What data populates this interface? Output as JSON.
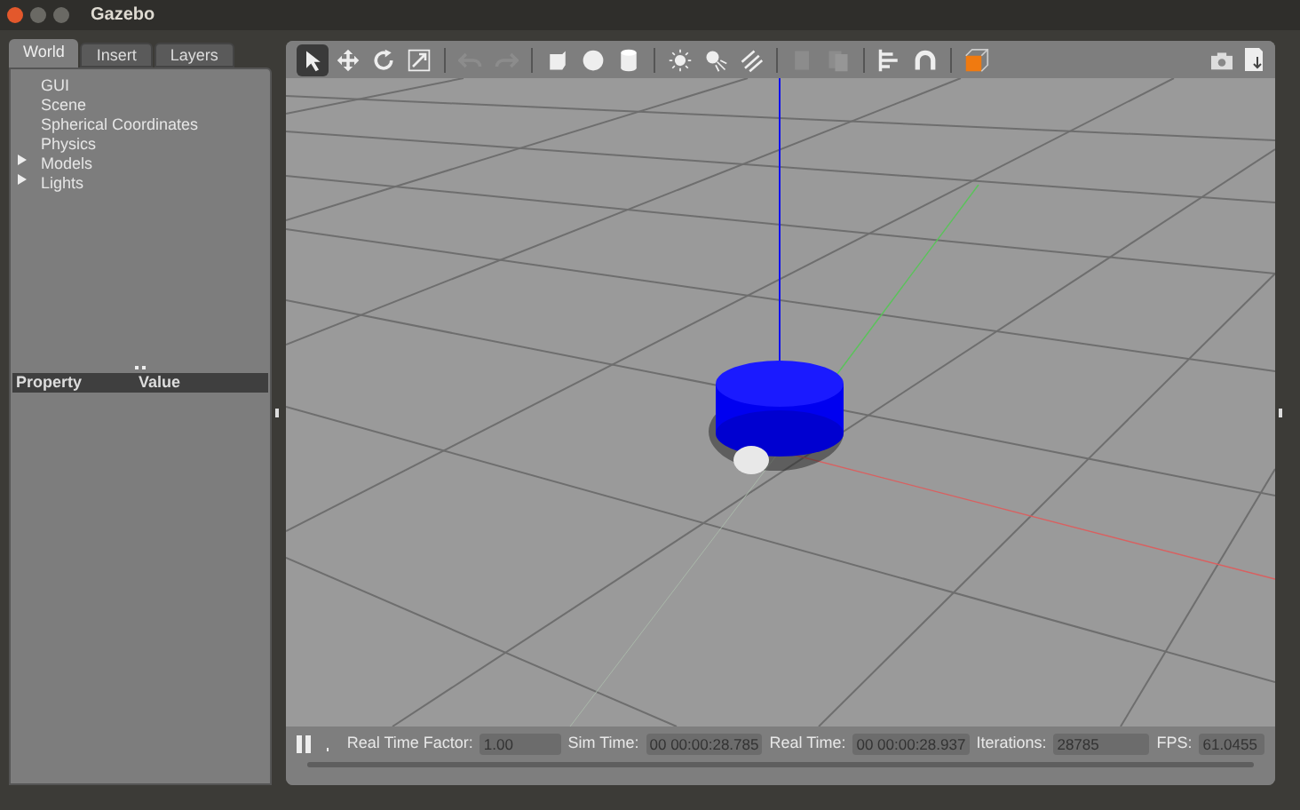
{
  "window": {
    "title": "Gazebo"
  },
  "tabs": [
    {
      "label": "World",
      "selected": true
    },
    {
      "label": "Insert",
      "selected": false
    },
    {
      "label": "Layers",
      "selected": false
    }
  ],
  "tree": [
    {
      "label": "GUI",
      "has_children": false
    },
    {
      "label": "Scene",
      "has_children": false
    },
    {
      "label": "Spherical Coordinates",
      "has_children": false
    },
    {
      "label": "Physics",
      "has_children": false
    },
    {
      "label": "Models",
      "has_children": true,
      "expanded": false
    },
    {
      "label": "Lights",
      "has_children": true,
      "expanded": false
    }
  ],
  "property_table": {
    "columns": [
      "Property",
      "Value"
    ]
  },
  "toolbar": {
    "tools": [
      {
        "kind": "select",
        "selected": true
      },
      {
        "kind": "translate",
        "selected": false
      },
      {
        "kind": "rotate",
        "selected": false
      },
      {
        "kind": "scale",
        "selected": false
      },
      {
        "kind": "sep"
      },
      {
        "kind": "undo",
        "disabled": true
      },
      {
        "kind": "redo",
        "disabled": true
      },
      {
        "kind": "sep"
      },
      {
        "kind": "box"
      },
      {
        "kind": "sphere"
      },
      {
        "kind": "cylinder"
      },
      {
        "kind": "sep"
      },
      {
        "kind": "sun"
      },
      {
        "kind": "spot"
      },
      {
        "kind": "dirlight"
      },
      {
        "kind": "sep"
      },
      {
        "kind": "copy",
        "disabled": true
      },
      {
        "kind": "paste",
        "disabled": true
      },
      {
        "kind": "sep"
      },
      {
        "kind": "align"
      },
      {
        "kind": "magnet"
      },
      {
        "kind": "sep"
      },
      {
        "kind": "view"
      }
    ]
  },
  "status_bar": {
    "paused": true,
    "fields": [
      {
        "label": "Real Time Factor:",
        "value": "1.00"
      },
      {
        "label": "Sim Time:",
        "value": "00 00:00:28.785"
      },
      {
        "label": "Real Time:",
        "value": "00 00:00:28.937"
      },
      {
        "label": "Iterations:",
        "value": "28785"
      },
      {
        "label": "FPS:",
        "value": "61.0455"
      }
    ]
  }
}
